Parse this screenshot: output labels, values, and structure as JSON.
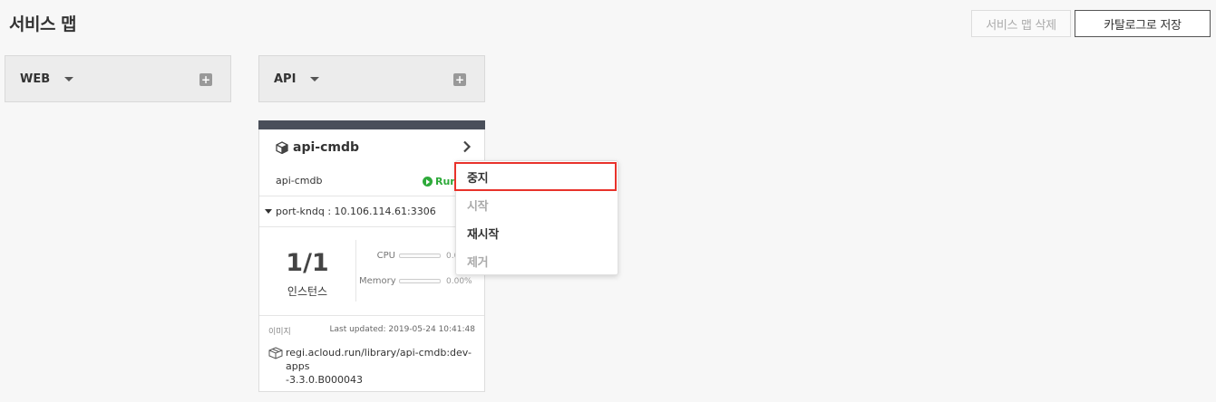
{
  "page": {
    "title": "서비스 맵"
  },
  "toolbar": {
    "delete_label": "서비스 맵 삭제",
    "save_label": "카탈로그로 저장"
  },
  "groups": [
    {
      "label": "WEB",
      "add_icon": "plus-box-icon"
    },
    {
      "label": "API",
      "add_icon": "plus-box-icon"
    }
  ],
  "card": {
    "name": "api-cmdb",
    "subtitle": "api-cmdb",
    "status": "Run",
    "status_color": "#2eaa3a",
    "port": "port-kndq : 10.106.114.61:3306",
    "instances": "1/1",
    "instances_label": "인스턴스",
    "metrics": {
      "cpu_label": "CPU",
      "cpu_value": "0.0",
      "cpu_fraction": 0,
      "memory_label": "Memory",
      "memory_value": "0.00%",
      "memory_fraction": 0
    },
    "image_label": "이미지",
    "last_updated": "Last updated: 2019-05-24 10:41:48",
    "image_path_1": "regi.acloud.run/library/api-cmdb:dev-apps",
    "image_path_2": "-3.3.0.B000043"
  },
  "menu": {
    "items": [
      {
        "label": "중지",
        "enabled": true,
        "highlighted": true
      },
      {
        "label": "시작",
        "enabled": false
      },
      {
        "label": "재시작",
        "enabled": true
      },
      {
        "label": "제거",
        "enabled": false
      }
    ],
    "highlight_color": "#e8322b"
  }
}
